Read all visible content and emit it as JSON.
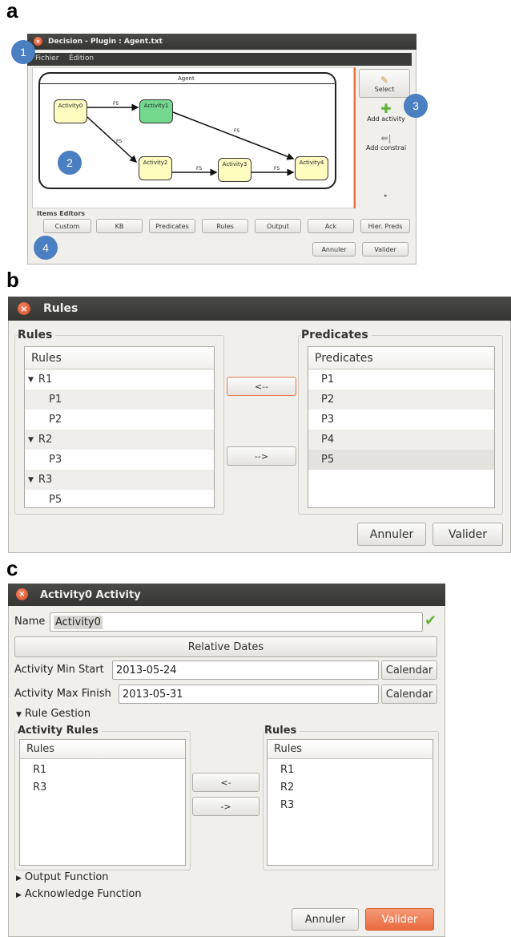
{
  "labels": {
    "a": "a",
    "b": "b",
    "c": "c"
  },
  "panel_a": {
    "title": "Decision - Plugin : Agent.txt",
    "menu": {
      "file": "Fichier",
      "edit": "Édition"
    },
    "canvas": {
      "container_title": "Agent",
      "nodes": [
        "Activity0",
        "Activity1",
        "Activity2",
        "Activity3",
        "Activity4"
      ],
      "edge_label": "FS"
    },
    "tools": {
      "select": "Select",
      "add_activity": "Add activity",
      "add_constraint": "Add constrai"
    },
    "items_editors_label": "Items Editors",
    "editors": [
      "Custom",
      "KB",
      "Predicates",
      "Rules",
      "Output",
      "Ack",
      "Hier. Preds"
    ],
    "cancel": "Annuler",
    "ok": "Valider",
    "callouts": [
      "1",
      "2",
      "3",
      "4"
    ]
  },
  "panel_b": {
    "title": "Rules",
    "left_group": "Rules",
    "left_header": "Rules",
    "rules_tree": [
      {
        "label": "R1",
        "type": "parent"
      },
      {
        "label": "P1",
        "type": "child"
      },
      {
        "label": "P2",
        "type": "child"
      },
      {
        "label": "R2",
        "type": "parent"
      },
      {
        "label": "P3",
        "type": "child"
      },
      {
        "label": "R3",
        "type": "parent"
      },
      {
        "label": "P5",
        "type": "child"
      }
    ],
    "add_button": "<--",
    "remove_button": "-->",
    "right_group": "Predicates",
    "right_header": "Predicates",
    "predicates": [
      "P1",
      "P2",
      "P3",
      "P4",
      "P5"
    ],
    "cancel": "Annuler",
    "ok": "Valider"
  },
  "panel_c": {
    "title": "Activity0 Activity",
    "name_label": "Name",
    "name_value": "Activity0",
    "relative_dates": "Relative Dates",
    "min_start_label": "Activity Min Start",
    "min_start_value": "2013-05-24",
    "max_finish_label": "Activity Max Finish",
    "max_finish_value": "2013-05-31",
    "calendar": "Calendar",
    "rule_gestion": "Rule Gestion",
    "activity_rules_group": "Activity Rules",
    "activity_rules_header": "Rules",
    "activity_rules": [
      "R1",
      "R3"
    ],
    "add_button": "<-",
    "remove_button": "->",
    "rules_group": "Rules",
    "rules_header": "Rules",
    "rules": [
      "R1",
      "R2",
      "R3"
    ],
    "output_function": "Output Function",
    "acknowledge_function": "Acknowledge Function",
    "cancel": "Annuler",
    "ok": "Valider"
  },
  "colors": {
    "titlebar": "#3e3e3b",
    "close": "#e0552a",
    "accent": "#e8703f",
    "green_node": "#74d88e",
    "yellow_node": "#fffcc0",
    "badge": "#4a7fc1"
  }
}
